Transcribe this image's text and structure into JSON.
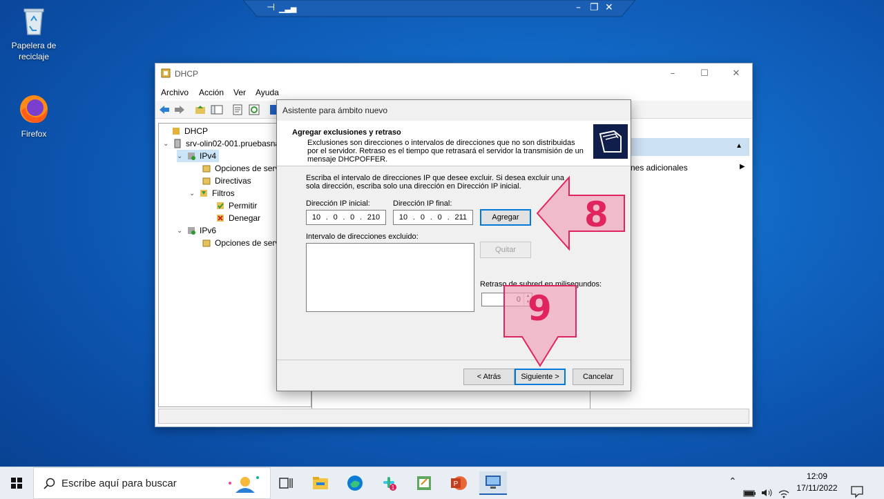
{
  "desktop": {
    "icons": [
      {
        "label": "Papelera de reciclaje",
        "icon": "recycle-bin-icon"
      },
      {
        "label": "Firefox",
        "icon": "firefox-icon"
      }
    ]
  },
  "rdp_bar": {
    "minimize": "–",
    "restore": "❐",
    "close": "✕"
  },
  "dhcp_window": {
    "title": "DHCP",
    "menu": [
      "Archivo",
      "Acción",
      "Ver",
      "Ayuda"
    ],
    "tree": [
      {
        "label": "DHCP",
        "icon": "dhcp-icon"
      },
      {
        "label": "srv-olin02-001.pruebasna",
        "icon": "server-icon"
      },
      {
        "label": "IPv4",
        "icon": "ipv4-icon"
      },
      {
        "label": "Opciones de servi",
        "icon": "options-icon"
      },
      {
        "label": "Directivas",
        "icon": "folder-icon"
      },
      {
        "label": "Filtros",
        "icon": "filter-icon"
      },
      {
        "label": "Permitir",
        "icon": "allow-icon"
      },
      {
        "label": "Denegar",
        "icon": "deny-icon"
      },
      {
        "label": "IPv6",
        "icon": "ipv6-icon"
      },
      {
        "label": "Opciones de servi",
        "icon": "options-icon"
      }
    ],
    "actions_item": "nes adicionales"
  },
  "wizard": {
    "title": "Asistente para ámbito nuevo",
    "header_title": "Agregar exclusiones y retraso",
    "header_desc": "Exclusiones son direcciones o intervalos de direcciones que no son distribuidas por el servidor. Retraso es el tiempo que retrasará el servidor la transmisión de un mensaje DHCPOFFER.",
    "instructions": "Escriba el intervalo de direcciones IP que desee excluir. Si desea excluir una sola dirección, escriba solo una dirección en Dirección IP inicial.",
    "start_ip_label": "Dirección IP inicial:",
    "end_ip_label": "Dirección IP final:",
    "start_ip": [
      "10",
      "0",
      "0",
      "210"
    ],
    "end_ip": [
      "10",
      "0",
      "0",
      "211"
    ],
    "add_button": "Agregar",
    "excluded_label": "Intervalo de direcciones excluido:",
    "remove_button": "Quitar",
    "delay_label": "Retraso de subred en milisegundos:",
    "delay_value": "0",
    "back_button": "< Atrás",
    "next_button": "Siguiente >",
    "cancel_button": "Cancelar"
  },
  "annotations": {
    "step_a": "8",
    "step_b": "9",
    "color": "#e0245e"
  },
  "taskbar": {
    "search_placeholder": "Escribe aquí para buscar",
    "time": "12:09",
    "date": "17/11/2022",
    "apps": [
      "task-view-icon",
      "file-explorer-icon",
      "edge-icon",
      "slack-icon",
      "notepad-icon",
      "powerpoint-icon",
      "remote-desktop-icon"
    ]
  }
}
